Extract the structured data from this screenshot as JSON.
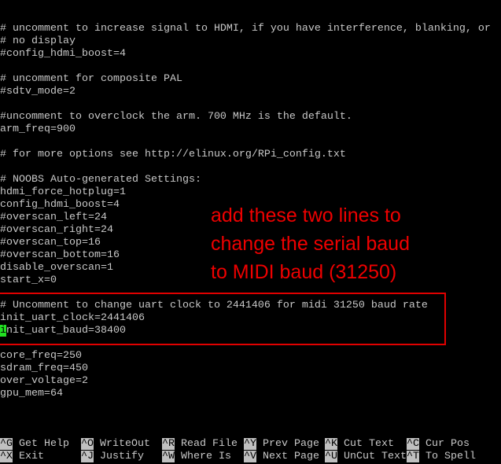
{
  "editor": {
    "cursor_line": 24,
    "lines": [
      "# uncomment to increase signal to HDMI, if you have interference, blanking, or",
      "# no display",
      "#config_hdmi_boost=4",
      "",
      "# uncomment for composite PAL",
      "#sdtv_mode=2",
      "",
      "#uncomment to overclock the arm. 700 MHz is the default.",
      "arm_freq=900",
      "",
      "# for more options see http://elinux.org/RPi_config.txt",
      "",
      "# NOOBS Auto-generated Settings:",
      "hdmi_force_hotplug=1",
      "config_hdmi_boost=4",
      "#overscan_left=24",
      "#overscan_right=24",
      "#overscan_top=16",
      "#overscan_bottom=16",
      "disable_overscan=1",
      "start_x=0",
      "",
      "# Uncomment to change uart clock to 2441406 for midi 31250 baud rate",
      "init_uart_clock=2441406",
      "init_uart_baud=38400",
      "",
      "core_freq=250",
      "sdram_freq=450",
      "over_voltage=2",
      "gpu_mem=64"
    ]
  },
  "annotation": {
    "lines": [
      "add these two lines to",
      "change the serial baud",
      "to MIDI baud (31250)"
    ],
    "color": "#ee0000"
  },
  "shortcuts": [
    [
      {
        "key": "^G",
        "label": "Get Help"
      },
      {
        "key": "^O",
        "label": "WriteOut"
      },
      {
        "key": "^R",
        "label": "Read File"
      },
      {
        "key": "^Y",
        "label": "Prev Page"
      },
      {
        "key": "^K",
        "label": "Cut Text"
      },
      {
        "key": "^C",
        "label": "Cur Pos"
      }
    ],
    [
      {
        "key": "^X",
        "label": "Exit"
      },
      {
        "key": "^J",
        "label": "Justify"
      },
      {
        "key": "^W",
        "label": "Where Is"
      },
      {
        "key": "^V",
        "label": "Next Page"
      },
      {
        "key": "^U",
        "label": "UnCut Text"
      },
      {
        "key": "^T",
        "label": "To Spell"
      }
    ]
  ]
}
